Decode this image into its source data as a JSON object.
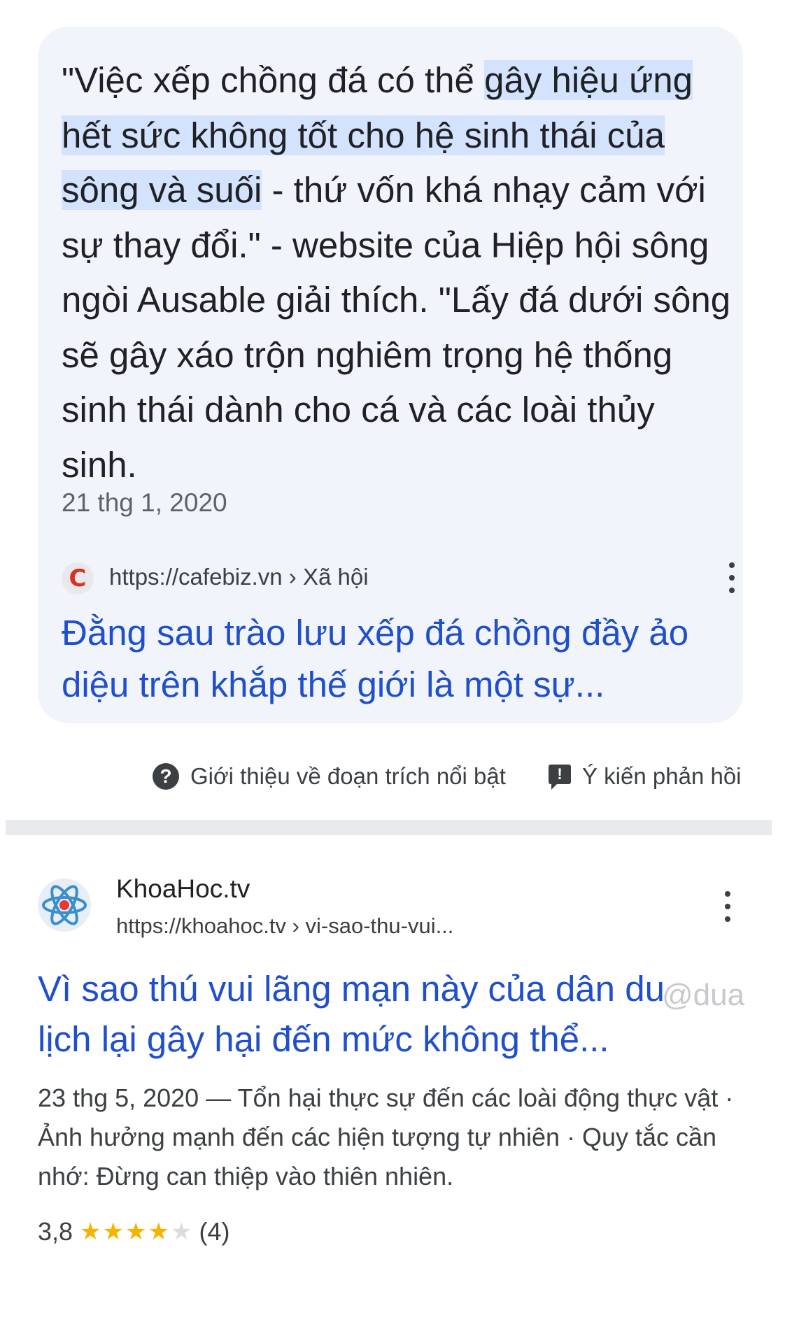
{
  "featured_snippet": {
    "text_plain_1": "\"Việc xếp chồng đá có thể ",
    "text_highlight": "gây hiệu ứng hết sức không tốt cho hệ sinh thái của sông và suối",
    "text_plain_2": " - thứ vốn khá nhạy cảm với sự thay đổi.\" - website của Hiệp hội sông ngòi Ausable giải thích. \"Lấy đá dưới sông sẽ gây xáo trộn nghiêm trọng hệ thống sinh thái dành cho cá và các loài thủy sinh.",
    "date": "21 thg 1, 2020",
    "favicon_letter": "C",
    "source_url": "https://cafebiz.vn › Xã hội",
    "link_title": "Đằng sau trào lưu xếp đá chồng đầy ảo diệu trên khắp thế giới là một sự..."
  },
  "footer": {
    "about_label": "Giới thiệu về đoạn trích nổi bật",
    "feedback_label": "Ý kiến phản hồi",
    "about_icon": "?",
    "feedback_icon": "!"
  },
  "result": {
    "site_name": "KhoaHoc.tv",
    "site_url": "https://khoahoc.tv › vi-sao-thu-vui...",
    "title": "Vì sao thú vui lãng mạn này của dân du lịch lại gây hại đến mức không thể...",
    "description": "23 thg 5, 2020 — Tổn hại thực sự đến các loài động thực vật · Ảnh hưởng mạnh đến các hiện tượng tự nhiên · Quy tắc cần nhớ: Đừng can thiệp vào thiên nhiên.",
    "rating_value": "3,8",
    "rating_stars": 3.8,
    "rating_count": "(4)"
  },
  "watermark": "@dua",
  "colors": {
    "link": "#1f4fcc",
    "highlight": "#d3e3fd",
    "card_bg": "#f1f4fa",
    "star": "#f4b400"
  },
  "icons": [
    "cafebiz-favicon-icon",
    "kebab-menu-icon",
    "help-circle-icon",
    "feedback-icon",
    "atom-icon",
    "star-icon"
  ]
}
